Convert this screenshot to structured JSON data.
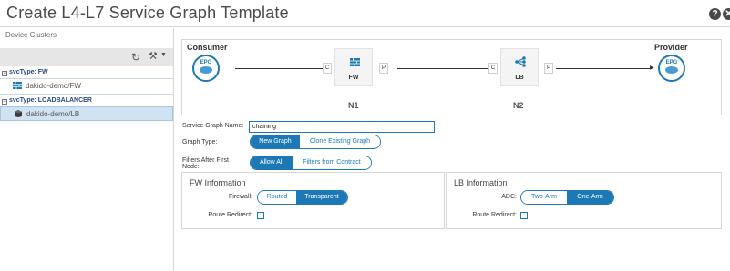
{
  "window": {
    "title": "Create L4-L7 Service Graph Template"
  },
  "device_clusters": {
    "label": "Device Clusters",
    "groups": [
      {
        "header": "svcType: FW",
        "items": [
          {
            "label": "dakido-demo/FW",
            "selected": false
          }
        ]
      },
      {
        "header": "svcType: LOADBALANCER",
        "items": [
          {
            "label": "dakido-demo/LB",
            "selected": true
          }
        ]
      }
    ]
  },
  "graph": {
    "consumer_label": "Consumer",
    "provider_label": "Provider",
    "epg_label": "EPG",
    "nodes": [
      {
        "type": "FW",
        "name": "N1",
        "connector_c": "C",
        "connector_p": "P"
      },
      {
        "type": "LB",
        "name": "N2",
        "connector_c": "C",
        "connector_p": "P"
      }
    ]
  },
  "form": {
    "service_graph_name": {
      "label": "Service Graph Name:",
      "value": "chaining"
    },
    "graph_type": {
      "label": "Graph Type:",
      "options": [
        "New Graph",
        "Clone Existing Graph"
      ],
      "selected": "New Graph"
    },
    "filters_after_first_node": {
      "label": "Filters After First Node:",
      "options": [
        "Allow All",
        "Filters from Contract"
      ],
      "selected": "Allow All"
    }
  },
  "fw_info": {
    "title": "FW Information",
    "firewall": {
      "label": "Firewall:",
      "options": [
        "Routed",
        "Transparent"
      ],
      "selected": "Transparent"
    },
    "route_redirect": {
      "label": "Route Redirect:",
      "checked": false
    }
  },
  "lb_info": {
    "title": "LB Information",
    "adc": {
      "label": "ADC:",
      "options": [
        "Two-Arm",
        "One-Arm"
      ],
      "selected": "One-Arm"
    },
    "route_redirect": {
      "label": "Route Redirect:",
      "checked": false
    }
  },
  "colors": {
    "accent": "#1d79b5",
    "selected_row": "#cfe3f3",
    "toolbar": "#e6e6e6"
  }
}
